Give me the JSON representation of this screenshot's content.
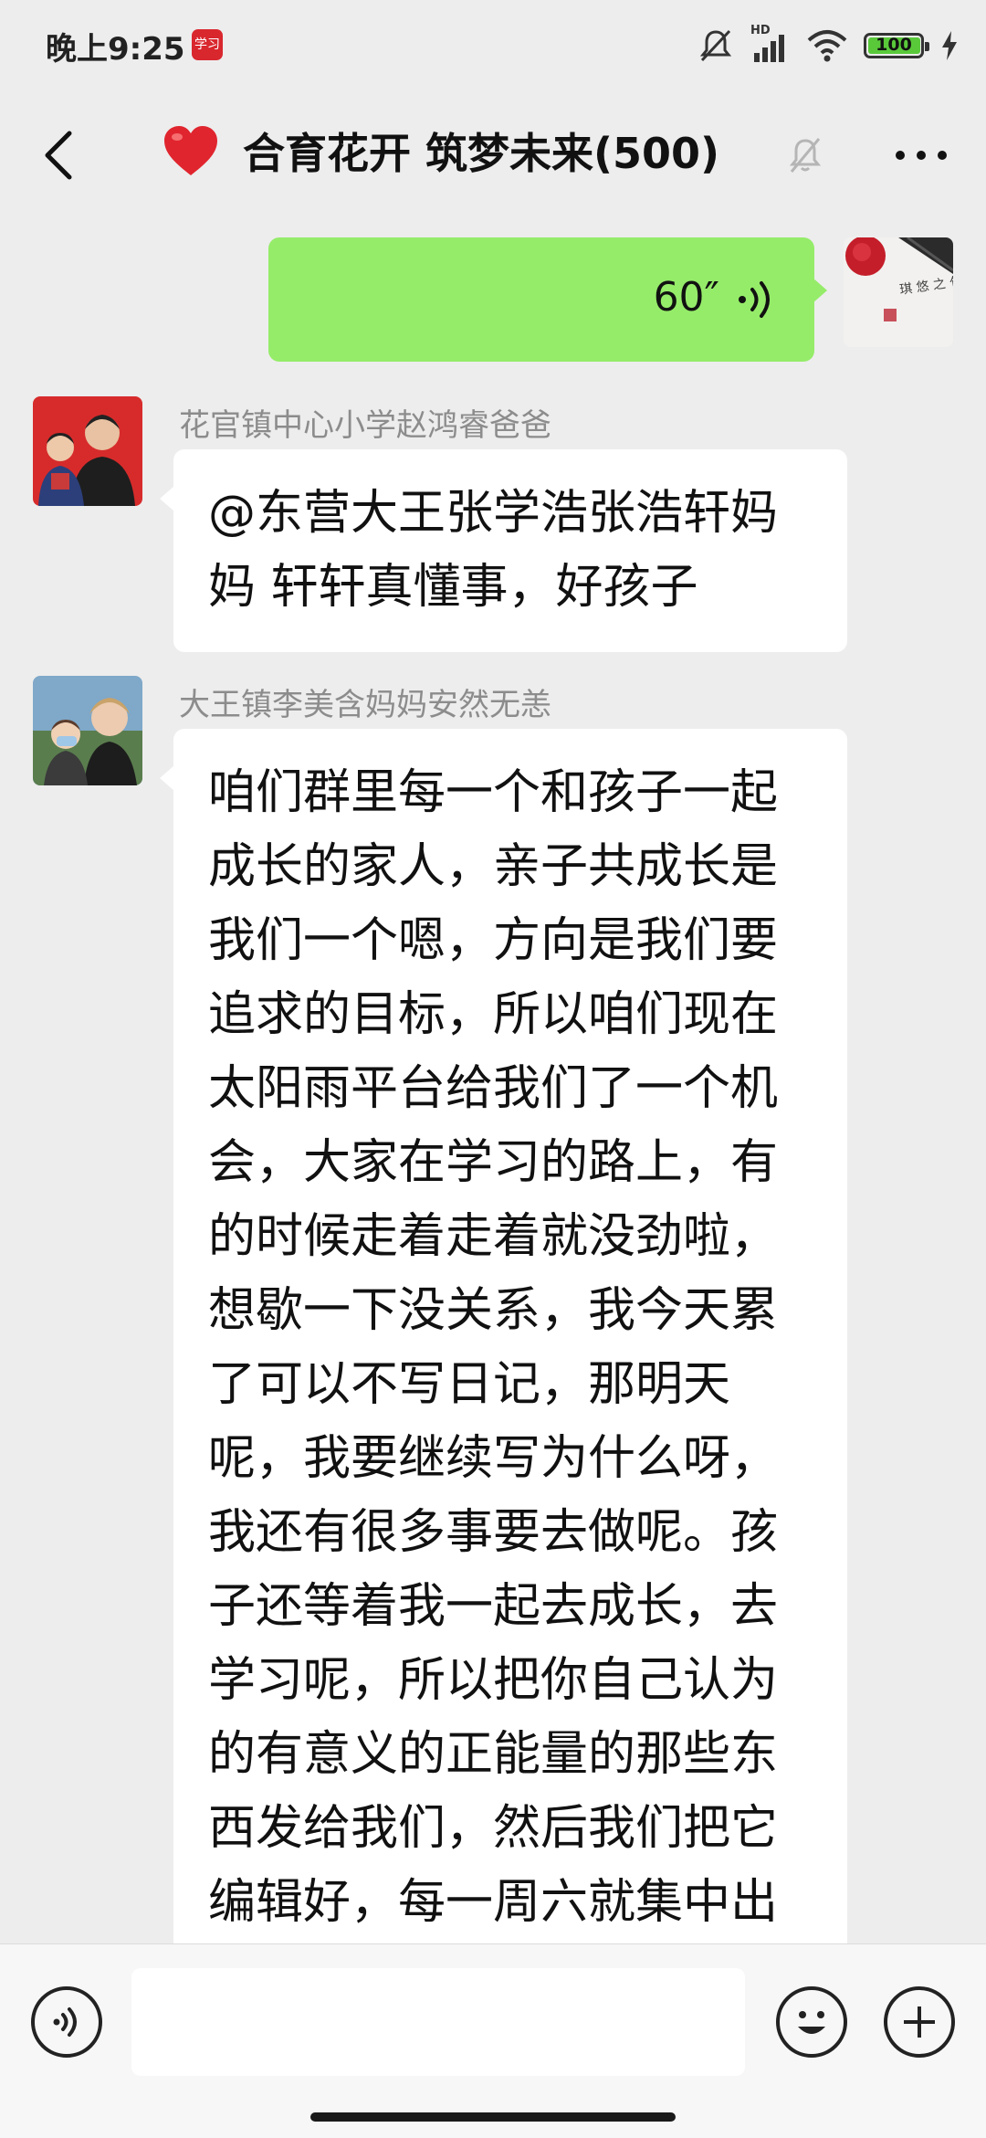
{
  "status_bar": {
    "time": "晚上9:25",
    "app_badge": "学习",
    "network_label": "HD",
    "battery": "100"
  },
  "header": {
    "title_emoji": "❤️",
    "title": "合育花开 筑梦未来(500)"
  },
  "messages": [
    {
      "type": "voice",
      "self": true,
      "duration": "60″",
      "avatar_seal_text": "琪 悠 之 句"
    },
    {
      "type": "text",
      "self": false,
      "sender": "花官镇中心小学赵鸿睿爸爸",
      "text": "@东营大王张学浩张浩轩妈妈  轩轩真懂事，好孩子"
    },
    {
      "type": "text",
      "self": false,
      "sender": "大王镇李美含妈妈安然无恙",
      "text": "咱们群里每一个和孩子一起成长的家人，亲子共成长是我们一个嗯，方向是我们要追求的目标，所以咱们现在太阳雨平台给我们了一个机会，大家在学习的路上，有的时候走着走着就没劲啦，想歇一下没关系，我今天累了可以不写日记，那明天呢，我要继续写为什么呀，我还有很多事要去做呢。孩子还等着我一起去成长，去学习呢，所以把你自己认为的有意义的正能量的那些东西发给我们，然后我们把它编辑好，每一周六就集中出版一"
    }
  ],
  "input_bar": {
    "placeholder": ""
  },
  "colors": {
    "background": "#ededed",
    "self_bubble": "#95ec69",
    "other_bubble": "#ffffff",
    "sender_name": "#8c8c8c"
  }
}
